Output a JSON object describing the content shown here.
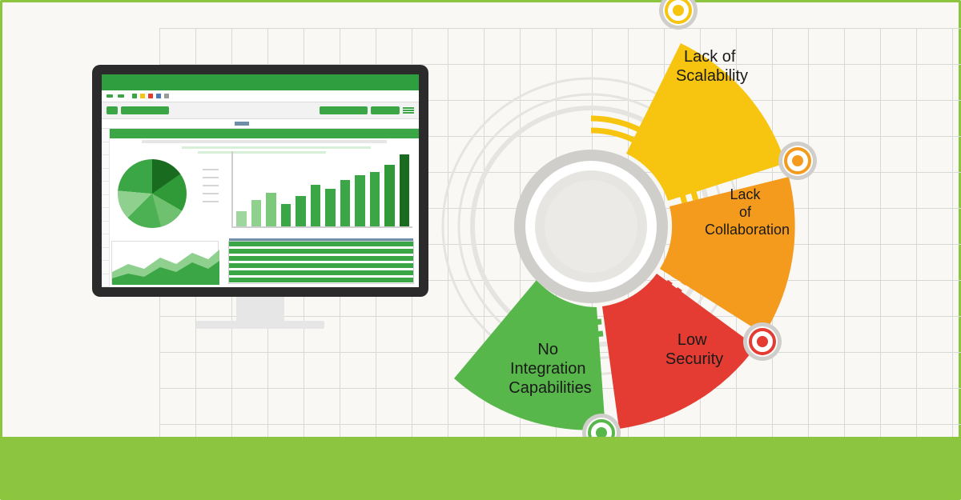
{
  "diagram": {
    "segments": [
      {
        "label_lines": [
          "Lack of",
          "Scalability"
        ],
        "color": "#f7c50f",
        "ring_color": "#f7c50f"
      },
      {
        "label_lines": [
          "Lack",
          "of",
          "Collaboration"
        ],
        "color": "#f49b1e",
        "ring_color": "#f49b1e"
      },
      {
        "label_lines": [
          "Low",
          "Security"
        ],
        "color": "#e43c33",
        "ring_color": "#e43c33"
      },
      {
        "label_lines": [
          "No",
          "Integration",
          "Capabilities"
        ],
        "color": "#57b74a",
        "ring_color": "#57b74a"
      }
    ],
    "center": {
      "fill": "#eceae6",
      "ring": "#cfcecb"
    },
    "radio_rings": {
      "outer": "#cfcecb",
      "gap": "#ffffff"
    }
  },
  "spreadsheet": {
    "accent": "#3aa646",
    "bar_chart": {
      "values": [
        20,
        35,
        45,
        30,
        40,
        55,
        50,
        62,
        68,
        72,
        82,
        96
      ]
    },
    "tab_colors": [
      "#3aa646",
      "#f7c50f",
      "#e43c33",
      "#4a7bb5",
      "#9a9a9a"
    ]
  },
  "colors": {
    "page_border": "#8cc63f",
    "footer_bar": "#8cc540",
    "grid_line": "#d8d8d6",
    "monitor_bezel": "#2b2b2b"
  }
}
